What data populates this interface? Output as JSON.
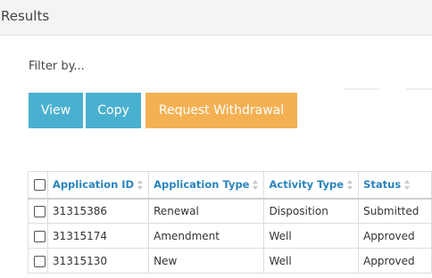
{
  "panel": {
    "title": "Results"
  },
  "filter": {
    "label": "Filter by..."
  },
  "actions": {
    "view_label": "View",
    "copy_label": "Copy",
    "withdraw_label": "Request Withdrawal"
  },
  "colors": {
    "primary_button": "#4ab0cf",
    "warning_button": "#f3b153",
    "header_link": "#2a84bd"
  },
  "table": {
    "columns": [
      "Application ID",
      "Application Type",
      "Activity Type",
      "Status"
    ],
    "rows": [
      [
        "31315386",
        "Renewal",
        "Disposition",
        "Submitted"
      ],
      [
        "31315174",
        "Amendment",
        "Well",
        "Approved"
      ],
      [
        "31315130",
        "New",
        "Well",
        "Approved"
      ]
    ]
  }
}
